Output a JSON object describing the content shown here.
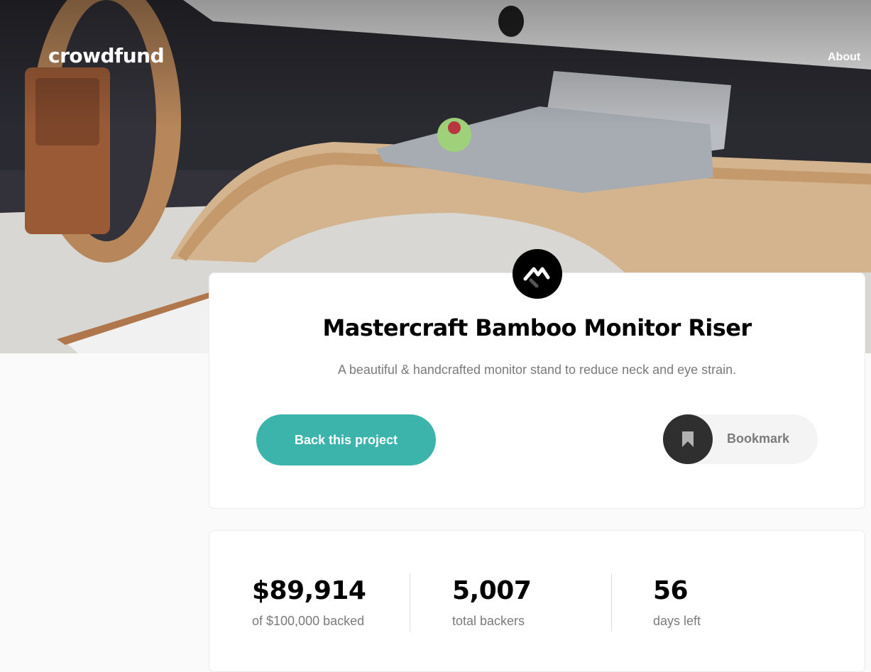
{
  "header": {
    "logo": "crowdfund",
    "nav_about": "About"
  },
  "project": {
    "title": "Mastercraft Bamboo Monitor Riser",
    "description": "A beautiful & handcrafted monitor stand to reduce neck and eye strain.",
    "logo_icon": "mastercraft-logo-icon",
    "back_button_label": "Back this project",
    "bookmark_label": "Bookmark",
    "bookmark_icon": "bookmark-icon"
  },
  "stats": [
    {
      "value": "$89,914",
      "label": "of $100,000 backed"
    },
    {
      "value": "5,007",
      "label": "total backers"
    },
    {
      "value": "56",
      "label": "days left"
    }
  ],
  "colors": {
    "accent": "#3cb4ac",
    "bookmark_circle": "#2f2f2f",
    "muted_text": "#7a7a7a"
  }
}
